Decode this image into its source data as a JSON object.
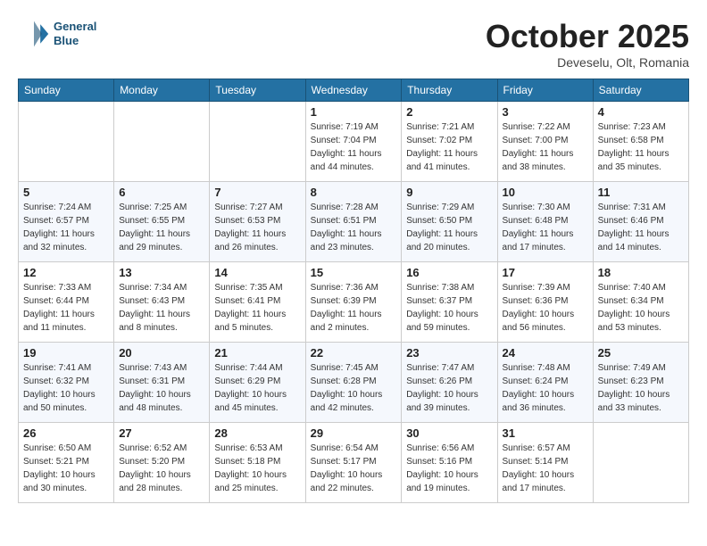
{
  "header": {
    "logo_line1": "General",
    "logo_line2": "Blue",
    "month": "October 2025",
    "location": "Deveselu, Olt, Romania"
  },
  "days_of_week": [
    "Sunday",
    "Monday",
    "Tuesday",
    "Wednesday",
    "Thursday",
    "Friday",
    "Saturday"
  ],
  "weeks": [
    [
      {
        "day": "",
        "sunrise": "",
        "sunset": "",
        "daylight": ""
      },
      {
        "day": "",
        "sunrise": "",
        "sunset": "",
        "daylight": ""
      },
      {
        "day": "",
        "sunrise": "",
        "sunset": "",
        "daylight": ""
      },
      {
        "day": "1",
        "sunrise": "Sunrise: 7:19 AM",
        "sunset": "Sunset: 7:04 PM",
        "daylight": "Daylight: 11 hours and 44 minutes."
      },
      {
        "day": "2",
        "sunrise": "Sunrise: 7:21 AM",
        "sunset": "Sunset: 7:02 PM",
        "daylight": "Daylight: 11 hours and 41 minutes."
      },
      {
        "day": "3",
        "sunrise": "Sunrise: 7:22 AM",
        "sunset": "Sunset: 7:00 PM",
        "daylight": "Daylight: 11 hours and 38 minutes."
      },
      {
        "day": "4",
        "sunrise": "Sunrise: 7:23 AM",
        "sunset": "Sunset: 6:58 PM",
        "daylight": "Daylight: 11 hours and 35 minutes."
      }
    ],
    [
      {
        "day": "5",
        "sunrise": "Sunrise: 7:24 AM",
        "sunset": "Sunset: 6:57 PM",
        "daylight": "Daylight: 11 hours and 32 minutes."
      },
      {
        "day": "6",
        "sunrise": "Sunrise: 7:25 AM",
        "sunset": "Sunset: 6:55 PM",
        "daylight": "Daylight: 11 hours and 29 minutes."
      },
      {
        "day": "7",
        "sunrise": "Sunrise: 7:27 AM",
        "sunset": "Sunset: 6:53 PM",
        "daylight": "Daylight: 11 hours and 26 minutes."
      },
      {
        "day": "8",
        "sunrise": "Sunrise: 7:28 AM",
        "sunset": "Sunset: 6:51 PM",
        "daylight": "Daylight: 11 hours and 23 minutes."
      },
      {
        "day": "9",
        "sunrise": "Sunrise: 7:29 AM",
        "sunset": "Sunset: 6:50 PM",
        "daylight": "Daylight: 11 hours and 20 minutes."
      },
      {
        "day": "10",
        "sunrise": "Sunrise: 7:30 AM",
        "sunset": "Sunset: 6:48 PM",
        "daylight": "Daylight: 11 hours and 17 minutes."
      },
      {
        "day": "11",
        "sunrise": "Sunrise: 7:31 AM",
        "sunset": "Sunset: 6:46 PM",
        "daylight": "Daylight: 11 hours and 14 minutes."
      }
    ],
    [
      {
        "day": "12",
        "sunrise": "Sunrise: 7:33 AM",
        "sunset": "Sunset: 6:44 PM",
        "daylight": "Daylight: 11 hours and 11 minutes."
      },
      {
        "day": "13",
        "sunrise": "Sunrise: 7:34 AM",
        "sunset": "Sunset: 6:43 PM",
        "daylight": "Daylight: 11 hours and 8 minutes."
      },
      {
        "day": "14",
        "sunrise": "Sunrise: 7:35 AM",
        "sunset": "Sunset: 6:41 PM",
        "daylight": "Daylight: 11 hours and 5 minutes."
      },
      {
        "day": "15",
        "sunrise": "Sunrise: 7:36 AM",
        "sunset": "Sunset: 6:39 PM",
        "daylight": "Daylight: 11 hours and 2 minutes."
      },
      {
        "day": "16",
        "sunrise": "Sunrise: 7:38 AM",
        "sunset": "Sunset: 6:37 PM",
        "daylight": "Daylight: 10 hours and 59 minutes."
      },
      {
        "day": "17",
        "sunrise": "Sunrise: 7:39 AM",
        "sunset": "Sunset: 6:36 PM",
        "daylight": "Daylight: 10 hours and 56 minutes."
      },
      {
        "day": "18",
        "sunrise": "Sunrise: 7:40 AM",
        "sunset": "Sunset: 6:34 PM",
        "daylight": "Daylight: 10 hours and 53 minutes."
      }
    ],
    [
      {
        "day": "19",
        "sunrise": "Sunrise: 7:41 AM",
        "sunset": "Sunset: 6:32 PM",
        "daylight": "Daylight: 10 hours and 50 minutes."
      },
      {
        "day": "20",
        "sunrise": "Sunrise: 7:43 AM",
        "sunset": "Sunset: 6:31 PM",
        "daylight": "Daylight: 10 hours and 48 minutes."
      },
      {
        "day": "21",
        "sunrise": "Sunrise: 7:44 AM",
        "sunset": "Sunset: 6:29 PM",
        "daylight": "Daylight: 10 hours and 45 minutes."
      },
      {
        "day": "22",
        "sunrise": "Sunrise: 7:45 AM",
        "sunset": "Sunset: 6:28 PM",
        "daylight": "Daylight: 10 hours and 42 minutes."
      },
      {
        "day": "23",
        "sunrise": "Sunrise: 7:47 AM",
        "sunset": "Sunset: 6:26 PM",
        "daylight": "Daylight: 10 hours and 39 minutes."
      },
      {
        "day": "24",
        "sunrise": "Sunrise: 7:48 AM",
        "sunset": "Sunset: 6:24 PM",
        "daylight": "Daylight: 10 hours and 36 minutes."
      },
      {
        "day": "25",
        "sunrise": "Sunrise: 7:49 AM",
        "sunset": "Sunset: 6:23 PM",
        "daylight": "Daylight: 10 hours and 33 minutes."
      }
    ],
    [
      {
        "day": "26",
        "sunrise": "Sunrise: 6:50 AM",
        "sunset": "Sunset: 5:21 PM",
        "daylight": "Daylight: 10 hours and 30 minutes."
      },
      {
        "day": "27",
        "sunrise": "Sunrise: 6:52 AM",
        "sunset": "Sunset: 5:20 PM",
        "daylight": "Daylight: 10 hours and 28 minutes."
      },
      {
        "day": "28",
        "sunrise": "Sunrise: 6:53 AM",
        "sunset": "Sunset: 5:18 PM",
        "daylight": "Daylight: 10 hours and 25 minutes."
      },
      {
        "day": "29",
        "sunrise": "Sunrise: 6:54 AM",
        "sunset": "Sunset: 5:17 PM",
        "daylight": "Daylight: 10 hours and 22 minutes."
      },
      {
        "day": "30",
        "sunrise": "Sunrise: 6:56 AM",
        "sunset": "Sunset: 5:16 PM",
        "daylight": "Daylight: 10 hours and 19 minutes."
      },
      {
        "day": "31",
        "sunrise": "Sunrise: 6:57 AM",
        "sunset": "Sunset: 5:14 PM",
        "daylight": "Daylight: 10 hours and 17 minutes."
      },
      {
        "day": "",
        "sunrise": "",
        "sunset": "",
        "daylight": ""
      }
    ]
  ]
}
